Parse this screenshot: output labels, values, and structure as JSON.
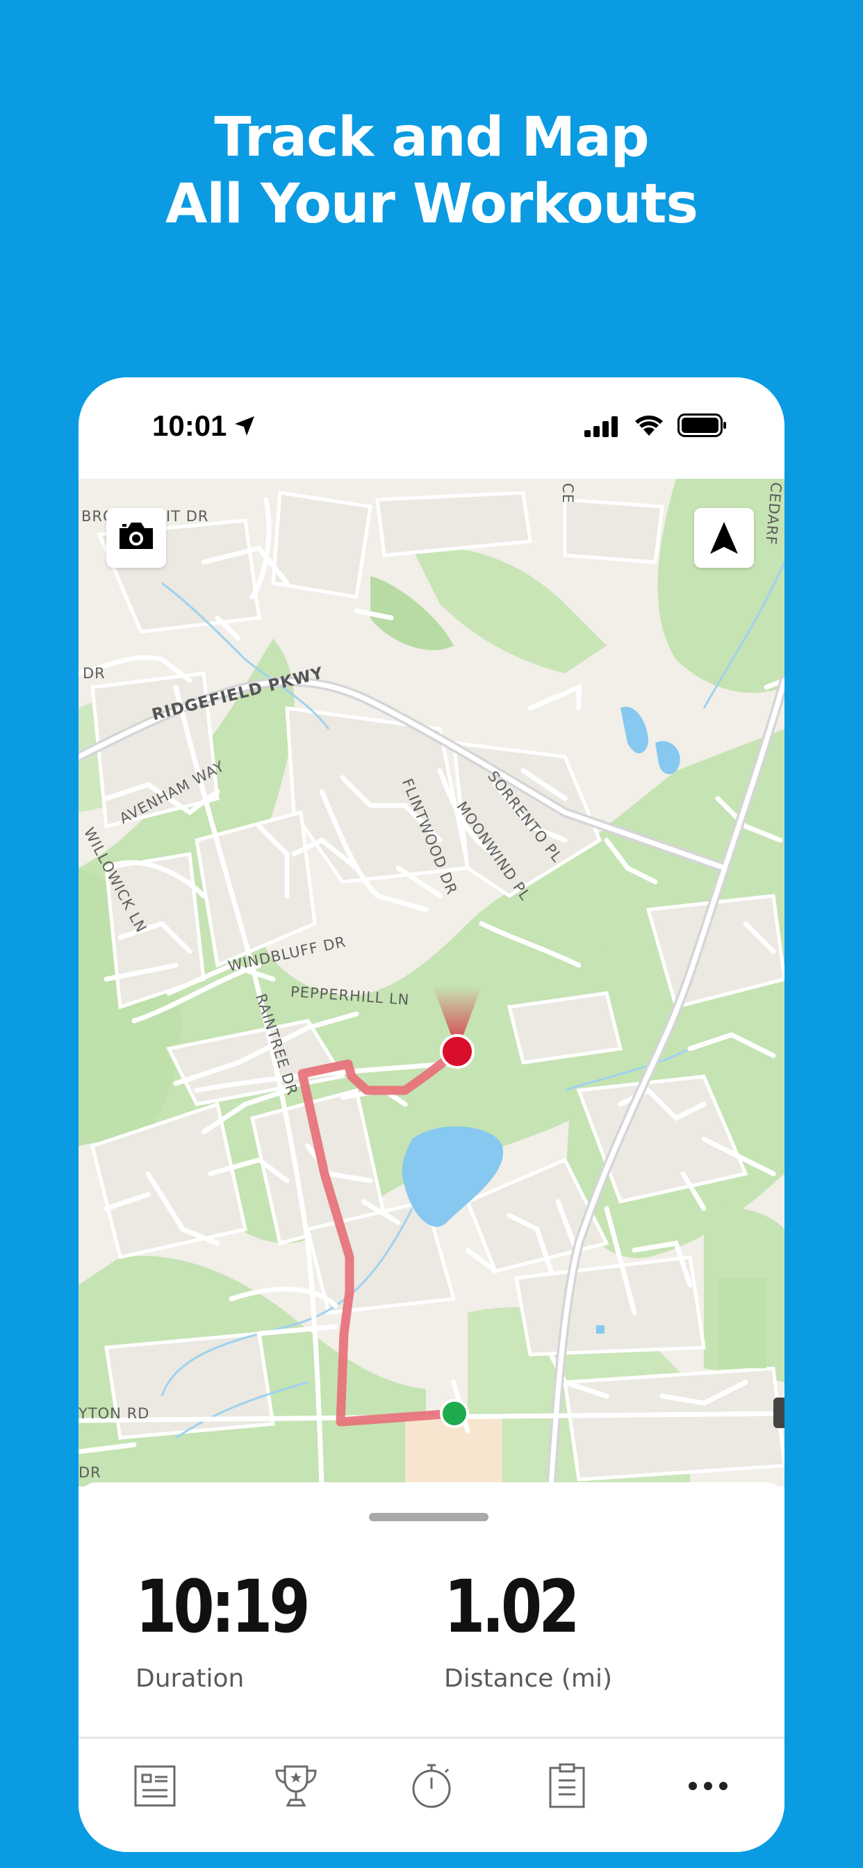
{
  "headline": {
    "line1": "Track and Map",
    "line2": "All Your Workouts"
  },
  "status_bar": {
    "time": "10:01"
  },
  "map": {
    "streets": [
      {
        "label": "BRO",
        "id": "bro"
      },
      {
        "label": "IT DR",
        "id": "itdr"
      },
      {
        "label": "RIDGEFIELD PKWY",
        "id": "ridgefield"
      },
      {
        "label": "AVENHAM WAY",
        "id": "avenham"
      },
      {
        "label": "WILLOWICK LN",
        "id": "willowick"
      },
      {
        "label": "FLINTWOOD DR",
        "id": "flintwood"
      },
      {
        "label": "MOONWIND PL",
        "id": "moonwind"
      },
      {
        "label": "SORRENTO PL",
        "id": "sorrento"
      },
      {
        "label": "WINDBLUFF DR",
        "id": "windbluff"
      },
      {
        "label": "PEPPERHILL LN",
        "id": "pepperhill"
      },
      {
        "label": "RAINTREE DR",
        "id": "raintree"
      },
      {
        "label": "YTON RD",
        "id": "ytonrd"
      },
      {
        "label": "DR",
        "id": "dr1"
      },
      {
        "label": "DR",
        "id": "dr2"
      },
      {
        "label": "CEDARF",
        "id": "cedarf"
      },
      {
        "label": "CE",
        "id": "ce"
      }
    ],
    "route_color": "#e7707a",
    "start_color": "#1faa4e",
    "end_color": "#d90e2b"
  },
  "stats": {
    "duration_value": "10:19",
    "duration_label": "Duration",
    "distance_value": "1.02",
    "distance_label": "Distance (mi)"
  },
  "tabs": [
    {
      "icon": "feed-icon"
    },
    {
      "icon": "trophy-icon"
    },
    {
      "icon": "stopwatch-icon"
    },
    {
      "icon": "clipboard-icon"
    },
    {
      "icon": "more-icon"
    }
  ],
  "colors": {
    "background": "#0a9be2",
    "park": "#c6e3b3",
    "water": "#86c8ef",
    "land": "#f1efe8"
  }
}
